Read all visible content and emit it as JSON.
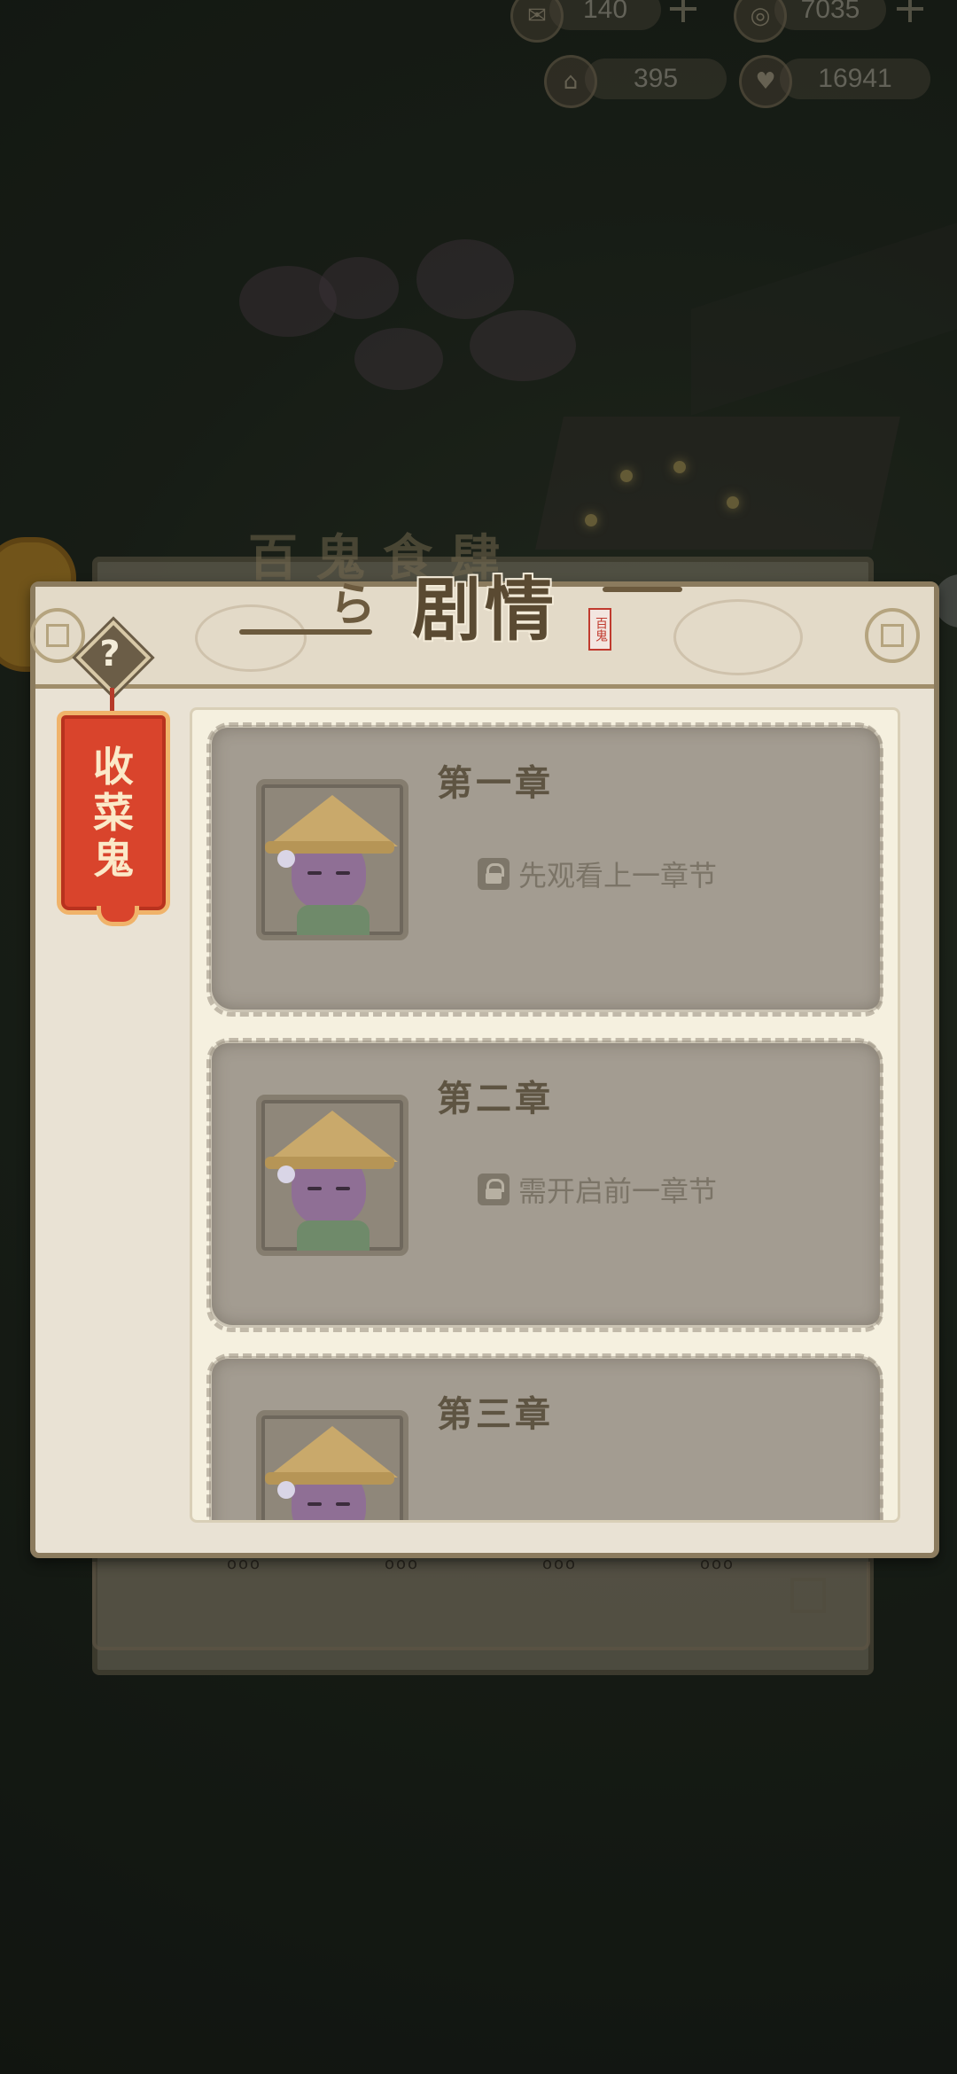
{
  "resources": [
    {
      "icon": "ticket-icon",
      "value": "140"
    },
    {
      "icon": "coin-icon",
      "value": "7035"
    },
    {
      "icon": "building-icon",
      "value": "395"
    },
    {
      "icon": "heart-icon",
      "value": "16941"
    }
  ],
  "back_panel": {
    "title": "百鬼食肆",
    "dots": "ooo"
  },
  "dialog": {
    "title": "剧情",
    "seal": "百鬼",
    "help_label": "?",
    "category_tab": "收菜鬼"
  },
  "chapters": [
    {
      "title": "第一章",
      "status": "先观看上一章节",
      "locked": true
    },
    {
      "title": "第二章",
      "status": "需开启前一章节",
      "locked": true
    },
    {
      "title": "第三章",
      "status": "",
      "locked": true
    }
  ],
  "colors": {
    "dialog_bg": "#e9e2d4",
    "card_bg": "#a39c91",
    "tab_red": "#d9442c",
    "title_brown": "#5a4a32"
  }
}
